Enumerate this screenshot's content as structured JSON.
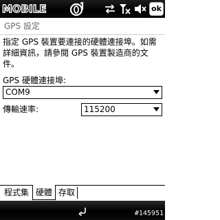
{
  "titlebar": {
    "brand": "MOBILE",
    "ok_label": "ok",
    "icons": [
      "mobile01-logo-icon",
      "sync-icon",
      "signal-off-icon",
      "speaker-muted-icon"
    ]
  },
  "page": {
    "title": "GPS 設定",
    "description": "指定 GPS 裝置要連接的硬體連接埠。如需詳細資訊，請參閱 GPS 裝置製造商的文件。"
  },
  "form": {
    "port_label": "GPS 硬體連接埠:",
    "port_value": "COM9",
    "baud_label": "傳輸速率:",
    "baud_value": "115200"
  },
  "tabs": [
    {
      "label": "程式集",
      "active": false
    },
    {
      "label": "硬體",
      "active": true
    },
    {
      "label": "存取",
      "active": false
    }
  ],
  "softkeys": {
    "watermark": "#145951"
  },
  "colors": {
    "titlebar_bg": "#000000",
    "page_title_text": "#6b6b6b",
    "body_bg": "#ffffff"
  }
}
